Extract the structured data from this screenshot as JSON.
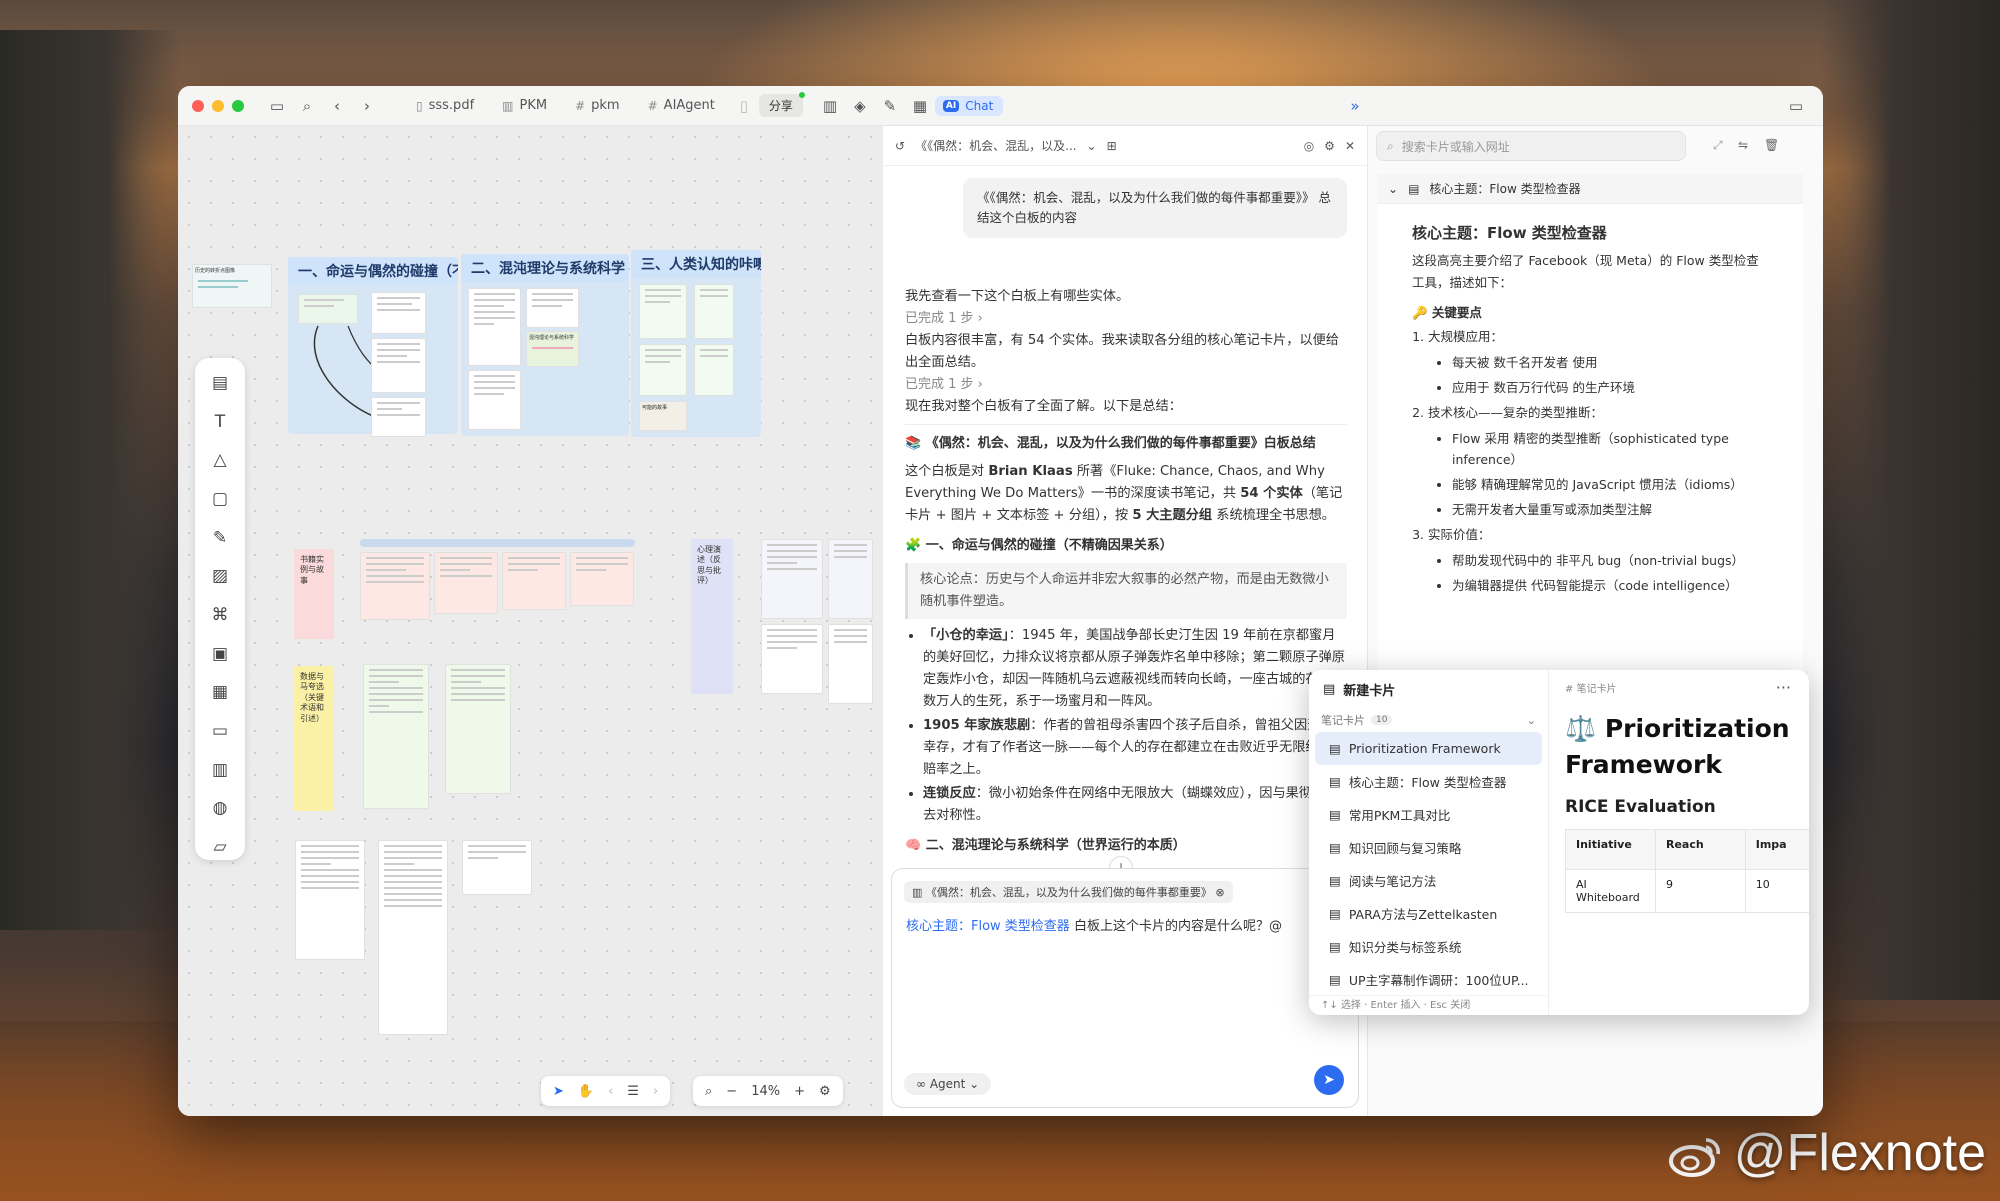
{
  "watermark": "@Flexnote",
  "titlebar": {
    "tabs": [
      {
        "icon": "pdf-icon",
        "label": "sss.pdf"
      },
      {
        "icon": "map-icon",
        "label": "PKM"
      },
      {
        "icon": "hash-icon",
        "label": "pkm"
      },
      {
        "icon": "hash-icon",
        "label": "AIAgent"
      }
    ],
    "share_label": "分享",
    "chat_label": "Chat",
    "chat_badge": "AI"
  },
  "canvas": {
    "groups": [
      {
        "title": "一、命运与偶然的碰撞（不计算"
      },
      {
        "title": "二、混沌理论与系统科学"
      },
      {
        "title": "三、人类认知的咔嚓"
      }
    ],
    "stickies": [
      {
        "text": "书籍实例与故事"
      },
      {
        "text": "数据与马夸选（关键术语和引述）"
      },
      {
        "text": "心理演述（反思与批评）"
      }
    ],
    "mini_texts": [
      "历史的转折点图像",
      "抗日战争故事的转折",
      "混沌理论与系统科学",
      "可能的故事"
    ],
    "zoom": "14%"
  },
  "chat": {
    "header_title": "《《偶然：机会、混乱，以及...",
    "user_message": "《《偶然：机会、混乱，以及为什么我们做的每件事都重要》》 总结这个白板的内容",
    "line1": "我先查看一下这个白板上有哪些实体。",
    "done1": "已完成 1 步 ›",
    "line2": "白板内容很丰富，有 54 个实体。我来读取各分组的核心笔记卡片，以便给出全面总结。",
    "done2": "已完成 1 步 ›",
    "line3": "现在我对整个白板有了全面了解。以下是总结：",
    "summary_title": "📚 《偶然：机会、混乱，以及为什么我们做的每件事都重要》白板总结",
    "summary_p1": "这个白板是对 ",
    "summary_author": "Brian Klaas",
    "summary_p2": " 所著《Fluke: Chance, Chaos, and Why Everything We Do Matters》一书的深度读书笔记，共 ",
    "summary_count": "54 个实体",
    "summary_p3": "（笔记卡片 + 图片 + 文本标签 + 分组），按 ",
    "summary_groups": "5 大主题分组",
    "summary_p4": " 系统梳理全书思想。",
    "section1": "🧩 一、命运与偶然的碰撞（不精确因果关系）",
    "quote1": "核心论点：历史与个人命运并非宏大叙事的必然产物，而是由无数微小随机事件塑造。",
    "bullets": [
      {
        "bold": "「小仓的幸运」",
        "text": "：1945 年，美国战争部长史汀生因 19 年前在京都蜜月的美好回忆，力排众议将京都从原子弹轰炸名单中移除；第二颗原子弹原定轰炸小仓，却因一阵随机乌云遮蔽视线而转向长崎，一座古城的存亡、数万人的生死，系于一场蜜月和一阵风。"
      },
      {
        "bold": "1905 年家族悲剧",
        "text": "：作者的曾祖母杀害四个孩子后自杀，曾祖父因天外出幸存，才有了作者这一脉——每个人的存在都建立在击败近乎无限统计学赔率之上。"
      },
      {
        "bold": "连锁反应",
        "text": "：微小初始条件在网络中无限放大（蝴蝶效应），因与果彻底失去对称性。"
      }
    ],
    "section2": "🧠 二、混沌理论与系统科学（世界运行的本质）",
    "input": {
      "chip": "《偶然：机会、混乱，以及为什么我们做的每件事都重要》",
      "mention": "核心主题：Flow 类型检查器",
      "text": " 白板上这个卡片的内容是什么呢？@",
      "agent_label": "Agent"
    }
  },
  "right": {
    "search_placeholder": "搜索卡片或输入网址",
    "note_title": "核心主题：Flow 类型检查器",
    "heading": "核心主题：Flow 类型检查器",
    "intro": "这段高亮主要介绍了 Facebook（现 Meta）的 Flow 类型检查工具，描述如下：",
    "key_points": "🔑 关键要点",
    "items": [
      {
        "title": "大规模应用：",
        "subs": [
          "每天被 数千名开发者 使用",
          "应用于 数百万行代码 的生产环境"
        ]
      },
      {
        "title": "技术核心——复杂的类型推断：",
        "subs": [
          "Flow 采用 精密的类型推断（sophisticated type inference）",
          "能够 精确理解常见的 JavaScript 惯用法（idioms）",
          "无需开发者大量重写或添加类型注解"
        ]
      },
      {
        "title": "实际价值：",
        "subs": [
          "帮助发现代码中的 非平凡 bug（non-trivial bugs）",
          "为编辑器提供 代码智能提示（code intelligence）"
        ]
      }
    ]
  },
  "popup": {
    "header": "新建卡片",
    "section": "笔记卡片",
    "count": "10",
    "items": [
      "Prioritization Framework",
      "核心主题：Flow 类型检查器",
      "常用PKM工具对比",
      "知识回顾与复习策略",
      "阅读与笔记方法",
      "PARA方法与Zettelkasten",
      "知识分类与标签系统",
      "UP主字幕制作调研：100位UP..."
    ],
    "footer": "↑↓ 选择 · Enter 插入 · Esc 关闭",
    "preview_tag": "# 笔记卡片",
    "preview_title": "⚖️ Prioritization Framework",
    "preview_sub": "RICE Evaluation",
    "table_headers": [
      "Initiative",
      "Reach",
      "Impa"
    ],
    "table_row": [
      "AI Whiteboard",
      "9",
      "10"
    ]
  }
}
